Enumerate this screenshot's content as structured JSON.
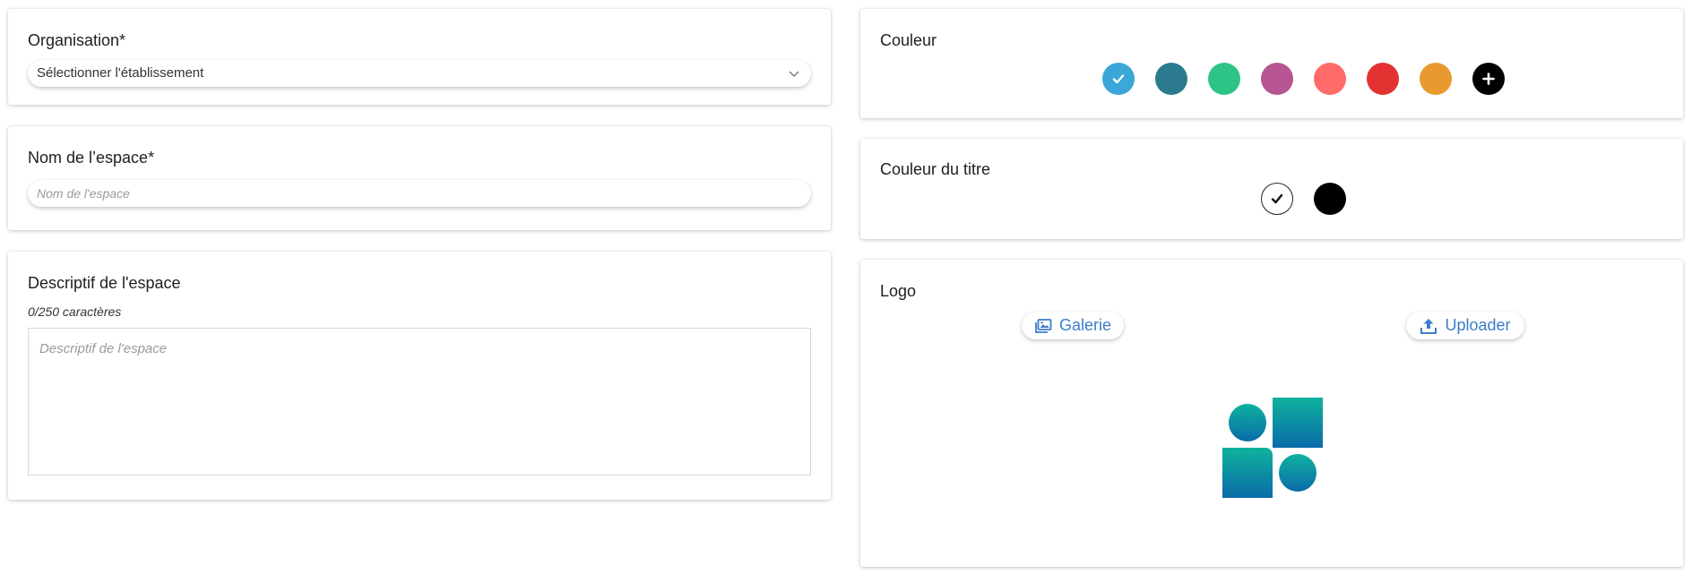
{
  "organisation": {
    "title": "Organisation*",
    "selected_value": "Sélectionner l'établissement",
    "chevron_icon": "chevron-down-icon"
  },
  "space_name": {
    "title": "Nom de l’espace*",
    "placeholder": "Nom de l'espace",
    "value": ""
  },
  "description": {
    "title": "Descriptif de l'espace",
    "counter": "0/250 caractères",
    "placeholder": "Descriptif de l'espace",
    "value": ""
  },
  "color": {
    "title": "Couleur",
    "swatches": [
      {
        "color": "#3aa7d8",
        "selected": true
      },
      {
        "color": "#2c7a8d",
        "selected": false
      },
      {
        "color": "#2ec487",
        "selected": false
      },
      {
        "color": "#b65591",
        "selected": false
      },
      {
        "color": "#ff6b69",
        "selected": false
      },
      {
        "color": "#e33232",
        "selected": false
      },
      {
        "color": "#e89a30",
        "selected": false
      }
    ],
    "add_button": {
      "color": "#000000",
      "icon": "plus-icon"
    }
  },
  "title_color": {
    "title": "Couleur du titre",
    "swatches": [
      {
        "color": "#ffffff",
        "selected": true
      },
      {
        "color": "#000000",
        "selected": false
      }
    ]
  },
  "logo": {
    "title": "Logo",
    "gallery_label": "Galerie",
    "gallery_icon": "image-gallery-icon",
    "upload_label": "Uploader",
    "upload_icon": "upload-icon",
    "preview_icon": "shapes-logo-icon",
    "accent_color": "#3d7dca"
  }
}
